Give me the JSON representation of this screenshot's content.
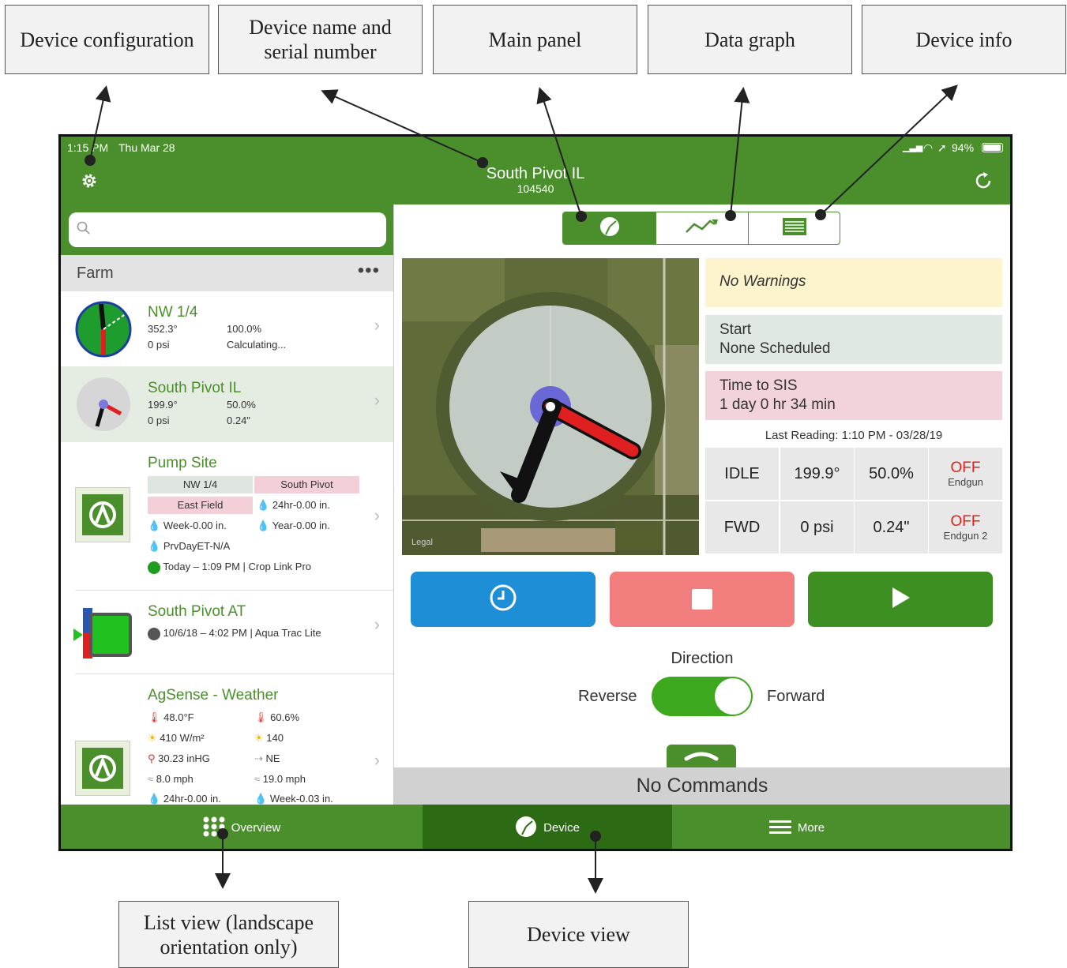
{
  "annotations": {
    "device_configuration": "Device configuration",
    "device_name_serial": "Device name and serial number",
    "main_panel": "Main panel",
    "data_graph": "Data graph",
    "device_info": "Device info",
    "list_view": "List view (landscape orientation only)",
    "device_view": "Device view"
  },
  "status": {
    "time": "1:15 PM",
    "date": "Thu Mar 28",
    "battery": "94%"
  },
  "header": {
    "device_name": "South Pivot IL",
    "serial": "104540"
  },
  "search": {
    "placeholder": ""
  },
  "farm": {
    "label": "Farm",
    "more": "•••"
  },
  "list": {
    "nw": {
      "title": "NW 1/4",
      "angle": "352.3°",
      "percent": "100.0%",
      "pressure": "0 psi",
      "status": "Calculating..."
    },
    "sp": {
      "title": "South Pivot IL",
      "angle": "199.9°",
      "percent": "50.0%",
      "pressure": "0 psi",
      "depth": "0.24\""
    },
    "pump": {
      "title": "Pump Site",
      "tag_nw": "NW 1/4",
      "tag_sp": "South Pivot",
      "tag_ef": "East Field",
      "h24": "24hr-0.00 in.",
      "week": "Week-0.00 in.",
      "year": "Year-0.00 in.",
      "prvday": "PrvDayET-N/A",
      "today": "Today – 1:09 PM | Crop Link Pro"
    },
    "spat": {
      "title": "South Pivot AT",
      "stamp": "10/6/18 – 4:02 PM | Aqua Trac Lite"
    },
    "weather": {
      "title": "AgSense - Weather",
      "temp": "48.0°F",
      "humidity": "60.6%",
      "solar": "410 W/m²",
      "solar2": "140",
      "pressure": "30.23 inHG",
      "wind_dir": "NE",
      "wind": "8.0 mph",
      "gust": "19.0 mph",
      "h24": "24hr-0.00 in.",
      "week": "Week-0.03 in."
    }
  },
  "panel": {
    "warnings": "No Warnings",
    "start_label": "Start",
    "start_value": "None Scheduled",
    "sis_label": "Time to SIS",
    "sis_value": "1 day 0 hr 34 min",
    "last_reading": "Last Reading: 1:10 PM -  03/28/19",
    "map_legal": "Legal",
    "grid": {
      "state": "IDLE",
      "angle": "199.9°",
      "percent": "50.0%",
      "endgun_val": "OFF",
      "endgun_label": "Endgun",
      "direction": "FWD",
      "pressure": "0 psi",
      "depth": "0.24\"",
      "endgun2_val": "OFF",
      "endgun2_label": "Endgun 2"
    },
    "direction_title": "Direction",
    "reverse": "Reverse",
    "forward": "Forward",
    "commands": "No Commands"
  },
  "tabs": {
    "overview": "Overview",
    "device": "Device",
    "more": "More"
  },
  "colors": {
    "brand_green": "#4a8f2c",
    "blue": "#1e8fd6",
    "stop": "#f27d7d",
    "warning_bg": "#fdf4cd",
    "start_bg": "#dfe8e1",
    "sis_bg": "#f3d3db"
  }
}
